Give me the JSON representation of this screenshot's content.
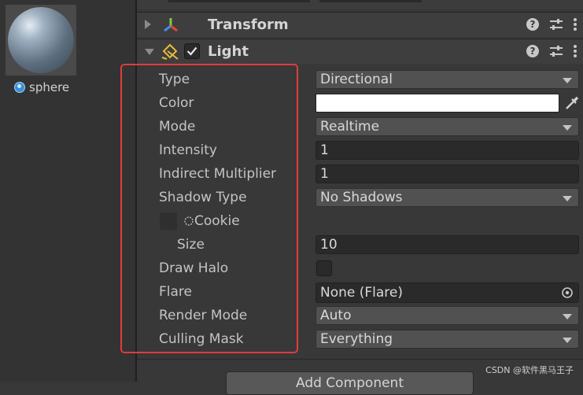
{
  "asset_preview": {
    "label": "sphere",
    "icon": "sphere-mesh-icon"
  },
  "components": [
    {
      "title": "Transform",
      "icon": "transform-axes-icon",
      "expanded": false
    },
    {
      "title": "Light",
      "icon": "light-icon",
      "expanded": true,
      "enabled": true
    }
  ],
  "header_icons": [
    "help-icon",
    "preset-sliders-icon",
    "context-menu-icon"
  ],
  "properties": {
    "type": {
      "label": "Type",
      "value": "Directional"
    },
    "color": {
      "label": "Color",
      "value": "#ffffff"
    },
    "mode": {
      "label": "Mode",
      "value": "Realtime"
    },
    "intensity": {
      "label": "Intensity",
      "value": "1"
    },
    "indirect_multiplier": {
      "label": "Indirect Multiplier",
      "value": "1"
    },
    "shadow_type": {
      "label": "Shadow Type",
      "value": "No Shadows"
    },
    "cookie": {
      "label": "Cookie"
    },
    "size": {
      "label": "Size",
      "value": "10"
    },
    "draw_halo": {
      "label": "Draw Halo",
      "checked": false
    },
    "flare": {
      "label": "Flare",
      "value": "None (Flare)"
    },
    "render_mode": {
      "label": "Render Mode",
      "value": "Auto"
    },
    "culling_mask": {
      "label": "Culling Mask",
      "value": "Everything"
    }
  },
  "add_component_label": "Add Component",
  "watermark": "CSDN @软件黑马王子",
  "colors": {
    "highlight": "#e03c3c",
    "panel_bg": "#383838",
    "field_bg": "#2a2a2a",
    "dropdown_bg": "#515151"
  }
}
